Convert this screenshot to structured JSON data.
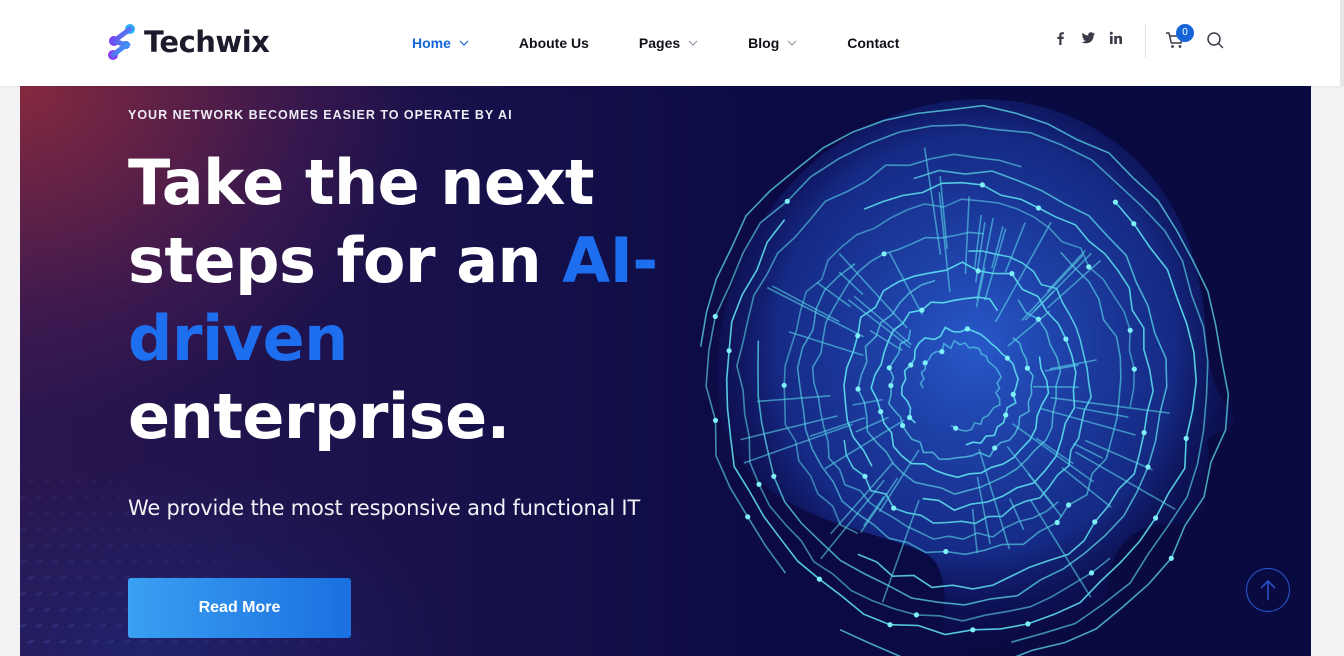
{
  "brand": {
    "name": "Techwix"
  },
  "nav": {
    "items": [
      {
        "label": "Home",
        "has_dropdown": true,
        "active": true
      },
      {
        "label": "Aboute Us",
        "has_dropdown": false,
        "active": false
      },
      {
        "label": "Pages",
        "has_dropdown": true,
        "active": false
      },
      {
        "label": "Blog",
        "has_dropdown": true,
        "active": false
      },
      {
        "label": "Contact",
        "has_dropdown": false,
        "active": false
      }
    ]
  },
  "social": {
    "icons": [
      "facebook-icon",
      "twitter-icon",
      "linkedin-icon"
    ]
  },
  "cart": {
    "count": "0"
  },
  "hero": {
    "eyebrow": "YOUR NETWORK BECOMES EASIER TO OPERATE BY AI",
    "headline_part1": "Take the next steps for an ",
    "headline_highlight": "AI-driven",
    "headline_part2": " enterprise.",
    "subtext": "We provide the most responsive and functional IT",
    "button_label": "Read More"
  },
  "colors": {
    "accent": "#1565d8",
    "highlight": "#1e6ef0",
    "circuit": "#5fe3f0"
  }
}
